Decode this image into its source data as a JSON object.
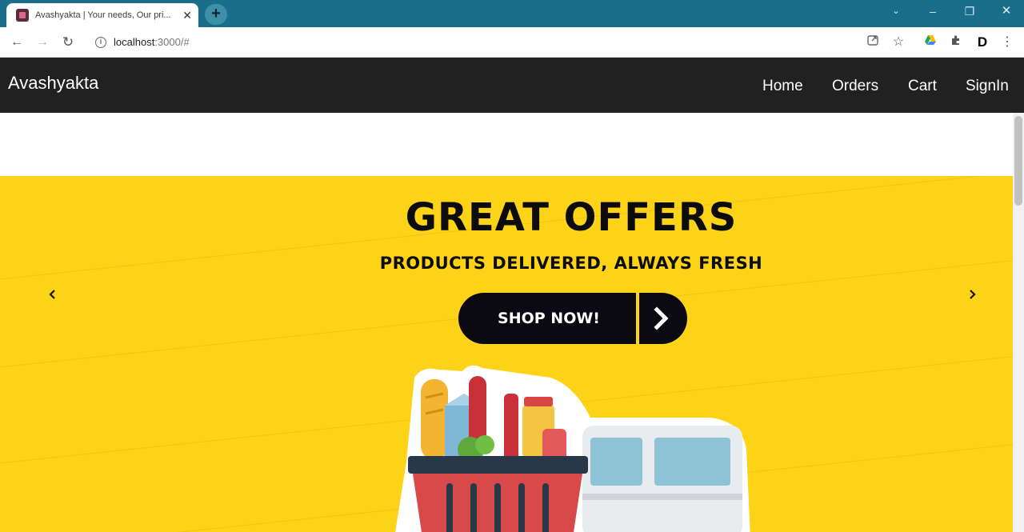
{
  "browser": {
    "tab_title": "Avashyakta | Your needs, Our pri...",
    "new_tab_symbol": "+",
    "url_host": "localhost",
    "url_rest": ":3000/#",
    "icons": [
      "back-arrow-icon",
      "forward-arrow-icon",
      "reload-icon",
      "info-icon",
      "share-icon",
      "star-icon",
      "drive-icon",
      "extensions-icon",
      "d-extension-icon",
      "kebab-menu-icon"
    ]
  },
  "navbar": {
    "brand": "Avashyakta",
    "links": [
      {
        "label": "Home"
      },
      {
        "label": "Orders"
      },
      {
        "label": "Cart"
      },
      {
        "label": "SignIn"
      }
    ]
  },
  "banner": {
    "headline": "GREAT OFFERS",
    "subline": "PRODUCTS DELIVERED, ALWAYS FRESH",
    "cta": "SHOP NOW!",
    "background_color": "#fcd316",
    "button_color": "#0b0a10"
  }
}
